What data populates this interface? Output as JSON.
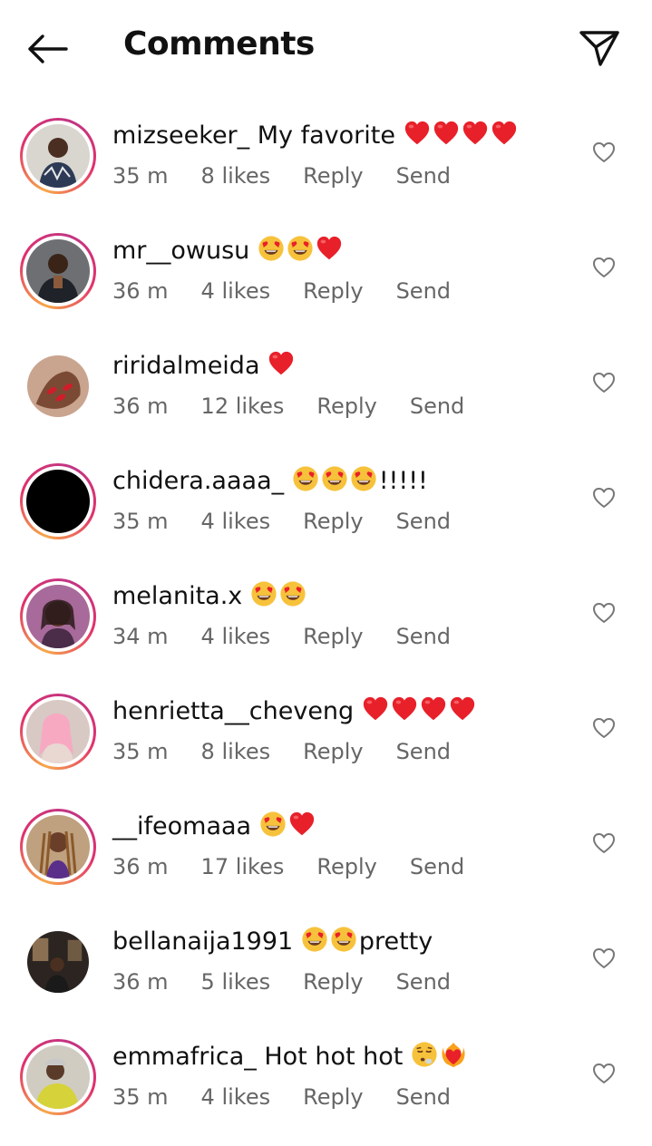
{
  "header": {
    "title": "Comments",
    "back_icon": "arrow-left-icon",
    "share_icon": "paper-plane-icon"
  },
  "colors": {
    "heart_red": "#e8202a",
    "meta_gray": "#666666",
    "story_ring": [
      "#f6a84a",
      "#e1306c",
      "#c13584"
    ]
  },
  "comments": [
    {
      "username": "mizseeker_",
      "text": "My favorite",
      "emojis": [
        "heart",
        "heart",
        "heart",
        "heart"
      ],
      "time": "35 m",
      "likes": "8 likes",
      "reply": "Reply",
      "send": "Send",
      "avatar_story_ring": true
    },
    {
      "username": "mr__owusu",
      "text": "",
      "emojis": [
        "heart-eyes",
        "heart-eyes",
        "heart"
      ],
      "time": "36 m",
      "likes": "4 likes",
      "reply": "Reply",
      "send": "Send",
      "avatar_story_ring": true
    },
    {
      "username": "riridalmeida",
      "text": "",
      "emojis": [
        "heart"
      ],
      "time": "36 m",
      "likes": "12 likes",
      "reply": "Reply",
      "send": "Send",
      "avatar_story_ring": false
    },
    {
      "username": "chidera.aaaa_",
      "text": "",
      "emojis": [
        "heart-eyes",
        "heart-eyes",
        "heart-eyes"
      ],
      "suffix": "!!!!!",
      "time": "35 m",
      "likes": "4 likes",
      "reply": "Reply",
      "send": "Send",
      "avatar_story_ring": true
    },
    {
      "username": "melanita.x",
      "text": "",
      "emojis": [
        "heart-eyes",
        "heart-eyes"
      ],
      "time": "34 m",
      "likes": "4 likes",
      "reply": "Reply",
      "send": "Send",
      "avatar_story_ring": true
    },
    {
      "username": "henrietta__cheveng",
      "text": "",
      "emojis": [
        "heart",
        "heart",
        "heart",
        "heart"
      ],
      "time": "35 m",
      "likes": "8 likes",
      "reply": "Reply",
      "send": "Send",
      "avatar_story_ring": true
    },
    {
      "username": "__ifeomaaa",
      "text": "",
      "emojis": [
        "heart-eyes",
        "heart"
      ],
      "time": "36 m",
      "likes": "17 likes",
      "reply": "Reply",
      "send": "Send",
      "avatar_story_ring": true
    },
    {
      "username": "bellanaija1991",
      "text": "",
      "emojis": [
        "heart-eyes",
        "heart-eyes"
      ],
      "suffix": "pretty",
      "time": "36 m",
      "likes": "5 likes",
      "reply": "Reply",
      "send": "Send",
      "avatar_story_ring": false
    },
    {
      "username": "emmafrica_",
      "text": "Hot hot hot",
      "emojis": [
        "face-exhaling",
        "heart-on-fire"
      ],
      "time": "35 m",
      "likes": "4 likes",
      "reply": "Reply",
      "send": "Send",
      "avatar_story_ring": true
    }
  ]
}
